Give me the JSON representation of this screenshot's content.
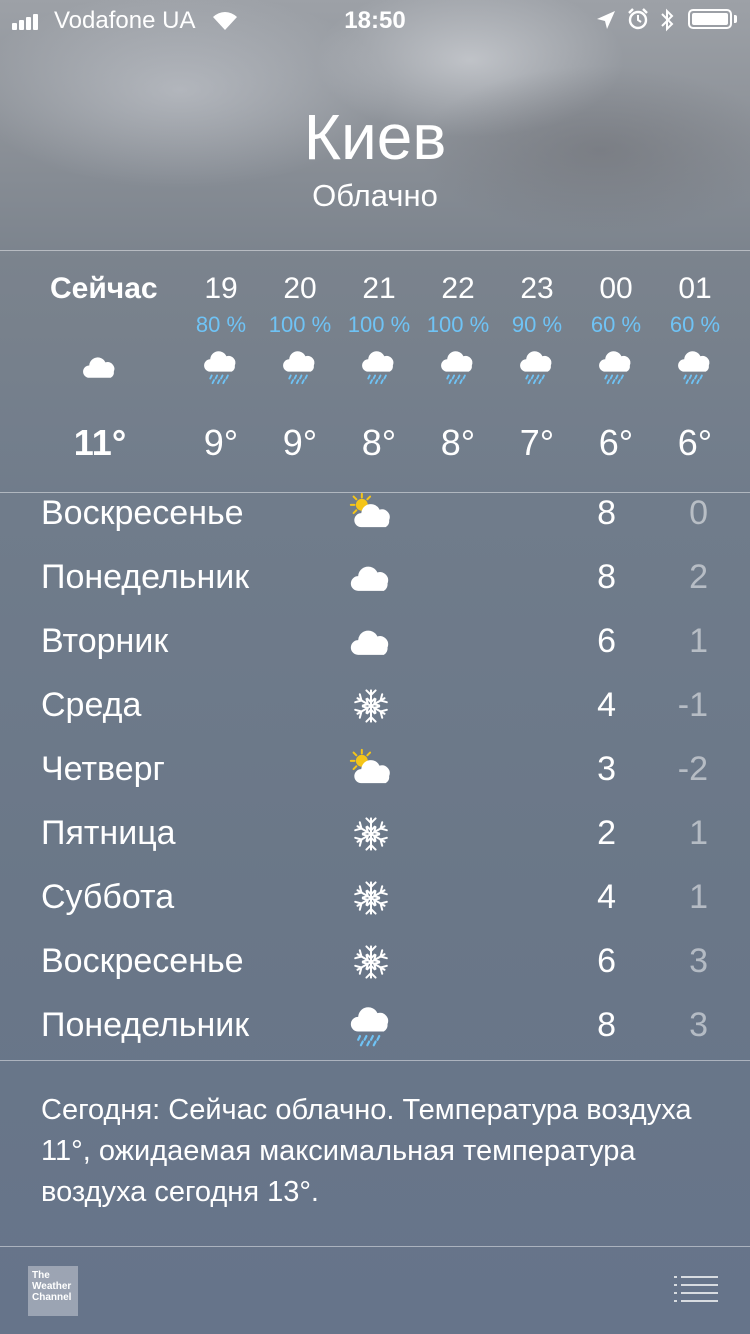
{
  "status_bar": {
    "carrier": "Vodafone UA",
    "time": "18:50",
    "signal_bars": 4,
    "icons": [
      "signal-icon",
      "wifi-icon",
      "location-arrow-icon",
      "alarm-icon",
      "bluetooth-icon",
      "battery-icon"
    ],
    "battery_level": 1.0
  },
  "header": {
    "city": "Киев",
    "condition": "Облачно"
  },
  "hourly": [
    {
      "label": "Сейчас",
      "prob": "",
      "icon": "cloud-icon",
      "temp": "11°",
      "now": true
    },
    {
      "label": "19",
      "prob": "80 %",
      "icon": "rain-cloud-icon",
      "temp": "9°"
    },
    {
      "label": "20",
      "prob": "100 %",
      "icon": "rain-cloud-icon",
      "temp": "9°"
    },
    {
      "label": "21",
      "prob": "100 %",
      "icon": "rain-cloud-icon",
      "temp": "8°"
    },
    {
      "label": "22",
      "prob": "100 %",
      "icon": "rain-cloud-icon",
      "temp": "8°"
    },
    {
      "label": "23",
      "prob": "90 %",
      "icon": "rain-cloud-icon",
      "temp": "7°"
    },
    {
      "label": "00",
      "prob": "60 %",
      "icon": "rain-cloud-icon",
      "temp": "6°"
    },
    {
      "label": "01",
      "prob": "60 %",
      "icon": "rain-cloud-icon",
      "temp": "6°"
    }
  ],
  "daily": [
    {
      "day": "Воскресенье",
      "icon": "partly-sunny-icon",
      "high": "8",
      "low": "0"
    },
    {
      "day": "Понедельник",
      "icon": "cloud-icon",
      "high": "8",
      "low": "2"
    },
    {
      "day": "Вторник",
      "icon": "cloud-icon",
      "high": "6",
      "low": "1"
    },
    {
      "day": "Среда",
      "icon": "snowflake-icon",
      "high": "4",
      "low": "-1"
    },
    {
      "day": "Четверг",
      "icon": "partly-sunny-icon",
      "high": "3",
      "low": "-2"
    },
    {
      "day": "Пятница",
      "icon": "snowflake-icon",
      "high": "2",
      "low": "1"
    },
    {
      "day": "Суббота",
      "icon": "snowflake-icon",
      "high": "4",
      "low": "1"
    },
    {
      "day": "Воскресенье",
      "icon": "snowflake-icon",
      "high": "6",
      "low": "3"
    },
    {
      "day": "Понедельник",
      "icon": "rain-cloud-icon",
      "high": "8",
      "low": "3"
    }
  ],
  "summary": "Сегодня: Сейчас облачно. Температура воздуха 11°, ожидаемая максимальная температура воздуха сегодня 13°.",
  "footer": {
    "logo_text": "The Weather Channel",
    "logo_icon": "weather-channel-logo",
    "menu_icon": "list-icon"
  },
  "colors": {
    "precip_blue": "#6fc3f5",
    "sun_yellow": "#f5c518",
    "low_temp": "rgba(255,255,255,0.5)"
  }
}
